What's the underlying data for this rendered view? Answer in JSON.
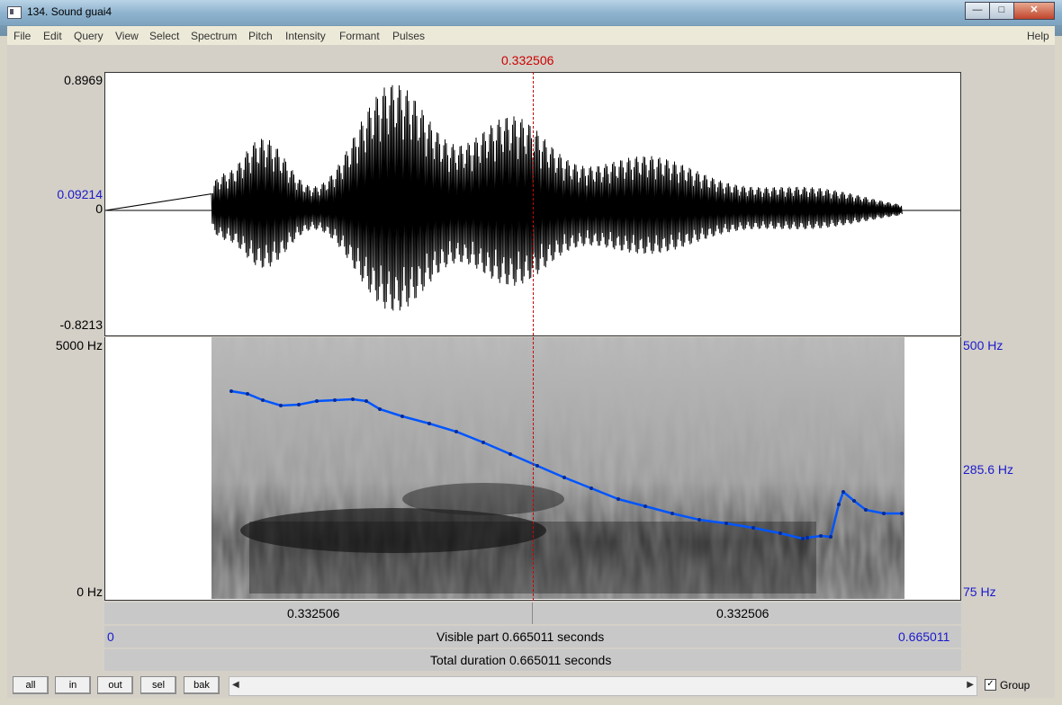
{
  "window": {
    "title": "134. Sound guai4"
  },
  "window_buttons": [
    "—",
    "□",
    "✕"
  ],
  "menu": {
    "items": [
      "File",
      "Edit",
      "Query",
      "View",
      "Select",
      "Spectrum",
      "Pitch",
      "Intensity",
      "Formant",
      "Pulses"
    ],
    "help": "Help"
  },
  "cursor": {
    "time": "0.332506"
  },
  "waveform": {
    "max_label": "0.8969",
    "cursor_value_label": "0.09214",
    "zero_label": "0",
    "min_label": "-0.8213"
  },
  "spectrogram": {
    "top_left": "5000 Hz",
    "bottom_left": "0 Hz",
    "pitch_top": "500 Hz",
    "pitch_mid": "285.6 Hz",
    "pitch_bottom": "75 Hz"
  },
  "time_bar": {
    "left_segment": "0.332506",
    "right_segment": "0.332506"
  },
  "visible_bar": {
    "start": "0",
    "text": "Visible part 0.665011 seconds",
    "end": "0.665011"
  },
  "total_bar": {
    "text": "Total duration 0.665011 seconds"
  },
  "buttons": {
    "all": "all",
    "in": "in",
    "out": "out",
    "sel": "sel",
    "bak": "bak"
  },
  "group": {
    "label": "Group",
    "checked": true
  },
  "colors": {
    "cursor": "#cc0000",
    "pitch": "#0055ff",
    "axis_blue": "#1a1acc"
  }
}
